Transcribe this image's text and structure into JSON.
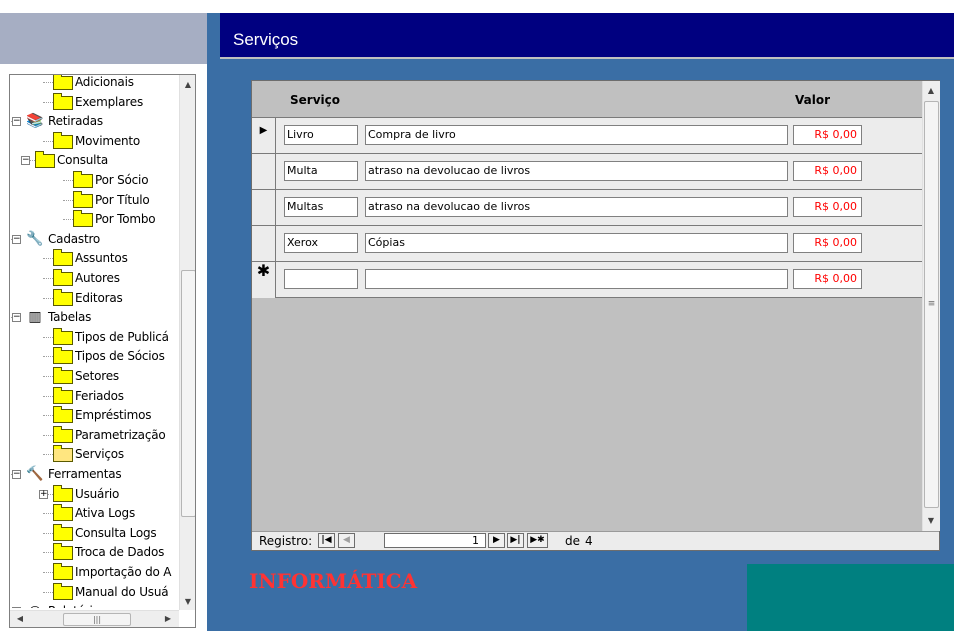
{
  "form": {
    "title": "Serviços"
  },
  "tree": {
    "items": [
      {
        "label": "Adicionais",
        "level": 2,
        "icon": "folder-icon"
      },
      {
        "label": "Exemplares",
        "level": 2,
        "icon": "folder-icon"
      },
      {
        "label": "Retiradas",
        "level": 0,
        "icon": "books-icon",
        "expander": "minus"
      },
      {
        "label": "Movimento",
        "level": 2,
        "icon": "folder-icon"
      },
      {
        "label": "Consulta",
        "level": 1,
        "icon": "folder-icon",
        "expander": "minus"
      },
      {
        "label": "Por Sócio",
        "level": 3,
        "icon": "folder-icon"
      },
      {
        "label": "Por Título",
        "level": 3,
        "icon": "folder-icon"
      },
      {
        "label": "Por Tombo",
        "level": 3,
        "icon": "folder-icon"
      },
      {
        "label": "Cadastro",
        "level": 0,
        "icon": "tools-icon",
        "expander": "minus"
      },
      {
        "label": "Assuntos",
        "level": 2,
        "icon": "folder-icon"
      },
      {
        "label": "Autores",
        "level": 2,
        "icon": "folder-icon"
      },
      {
        "label": "Editoras",
        "level": 2,
        "icon": "folder-icon"
      },
      {
        "label": "Tabelas",
        "level": 0,
        "icon": "table-icon",
        "expander": "minus"
      },
      {
        "label": "Tipos de Publicá",
        "level": 2,
        "icon": "folder-icon"
      },
      {
        "label": "Tipos de Sócios",
        "level": 2,
        "icon": "folder-icon"
      },
      {
        "label": "Setores",
        "level": 2,
        "icon": "folder-icon"
      },
      {
        "label": "Feriados",
        "level": 2,
        "icon": "folder-icon"
      },
      {
        "label": "Empréstimos",
        "level": 2,
        "icon": "folder-icon"
      },
      {
        "label": "Parametrização",
        "level": 2,
        "icon": "folder-icon"
      },
      {
        "label": "Serviços",
        "level": 2,
        "icon": "open-folder-icon"
      },
      {
        "label": "Ferramentas",
        "level": 0,
        "icon": "hammer-icon",
        "expander": "minus"
      },
      {
        "label": "Usuário",
        "level": 2,
        "icon": "folder-icon",
        "expander": "plus"
      },
      {
        "label": "Ativa Logs",
        "level": 2,
        "icon": "folder-icon"
      },
      {
        "label": "Consulta Logs",
        "level": 2,
        "icon": "folder-icon"
      },
      {
        "label": "Troca de Dados",
        "level": 2,
        "icon": "folder-icon"
      },
      {
        "label": "Importação do A",
        "level": 2,
        "icon": "folder-icon"
      },
      {
        "label": "Manual do Usuá",
        "level": 2,
        "icon": "folder-icon"
      },
      {
        "label": "Relatórios",
        "level": 0,
        "icon": "report-icon",
        "expander": "minus"
      }
    ]
  },
  "grid": {
    "headers": {
      "service": "Serviço",
      "value": "Valor"
    },
    "rows": [
      {
        "code": "Livro",
        "description": "Compra de livro",
        "value": "R$ 0,00",
        "marker": "current"
      },
      {
        "code": "Multa",
        "description": "atraso na devolucao de livros",
        "value": "R$ 0,00",
        "marker": ""
      },
      {
        "code": "Multas",
        "description": "atraso na devolucao de livros",
        "value": "R$ 0,00",
        "marker": ""
      },
      {
        "code": "Xerox",
        "description": "Cópias",
        "value": "R$ 0,00",
        "marker": ""
      },
      {
        "code": "",
        "description": "",
        "value": "R$ 0,00",
        "marker": "new"
      }
    ]
  },
  "navigation": {
    "label": "Registro:",
    "current": "1",
    "of_label": "de",
    "total": "4"
  },
  "footer": {
    "brand": "INFORMÁTICA"
  },
  "colors": {
    "title_bar": "#000080",
    "main_background": "#3a6ea5",
    "value_text": "#ff0000",
    "brand_text": "#ff3333",
    "teal_block": "#008080",
    "folder": "#ffff00"
  }
}
